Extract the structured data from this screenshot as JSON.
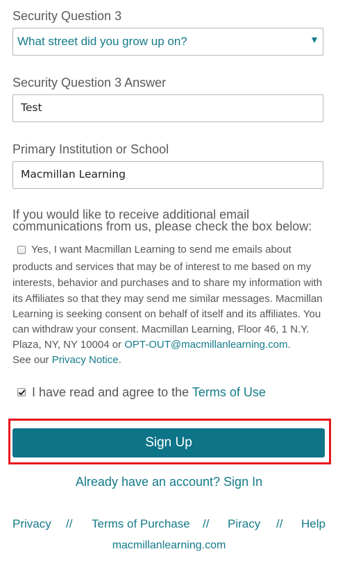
{
  "security_question": {
    "label": "Security Question 3",
    "selected": "What street did you grow up on?"
  },
  "security_answer": {
    "label": "Security Question 3 Answer",
    "value": "Test"
  },
  "institution": {
    "label": "Primary Institution or School",
    "value": "Macmillan Learning"
  },
  "email_prompt": {
    "line1": "If you would like to receive additional email",
    "line2": "communications from us, please check the box below:"
  },
  "consent": {
    "checked": false,
    "line1": "Yes, I want Macmillan Learning to send me emails about",
    "line2": "products and services that may be of interest to me based on my",
    "line3": "interests, behavior and purchases and to share my information with",
    "line4": "its Affiliates so that they may send me similar messages. Macmillan",
    "line5": "Learning is seeking consent on behalf of itself and its affiliates. You",
    "line6": "can withdraw your consent. Macmillan Learning, Floor 46, 1 N.Y.",
    "line7_prefix": "Plaza, NY, NY 10004 or ",
    "opt_out_link": "OPT-OUT@macmillanlearning.com",
    "line7_suffix": ".",
    "line8_prefix": "See our ",
    "privacy_notice_link": "Privacy Notice",
    "line8_suffix": "."
  },
  "terms": {
    "checked": true,
    "prefix": "I have read and agree to the ",
    "link": "Terms of Use"
  },
  "signup_button": "Sign Up",
  "signin_link": "Already have an account? Sign In",
  "footer": {
    "privacy": "Privacy",
    "separator": "//",
    "terms_of_purchase": "Terms of Purchase",
    "piracy": "Piracy",
    "help": "Help",
    "domain": "macmillanlearning.com"
  },
  "colors": {
    "accent": "#147a88",
    "button": "#0e7488",
    "highlight": "#e8141b"
  }
}
